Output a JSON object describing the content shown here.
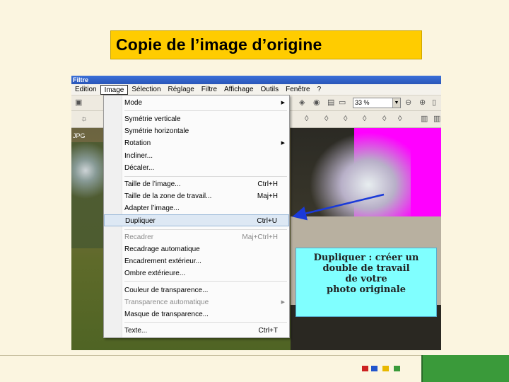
{
  "slide": {
    "title": "Copie de l’image d’origine"
  },
  "window": {
    "title": "Filtre",
    "doc_label": "JPG"
  },
  "menubar": [
    {
      "label": "Edition"
    },
    {
      "label": "Image"
    },
    {
      "label": "Sélection"
    },
    {
      "label": "Réglage"
    },
    {
      "label": "Filtre"
    },
    {
      "label": "Affichage"
    },
    {
      "label": "Outils"
    },
    {
      "label": "Fenêtre"
    },
    {
      "label": "?"
    }
  ],
  "toolbar": {
    "zoom": "33 %",
    "zoom_arrow": "▼"
  },
  "menu": {
    "items": [
      {
        "label": "Mode",
        "shortcut": "",
        "submenu": "▶",
        "disabled": false
      },
      {
        "label": "Symétrie verticale",
        "shortcut": "",
        "submenu": "",
        "disabled": false
      },
      {
        "label": "Symétrie horizontale",
        "shortcut": "",
        "submenu": "",
        "disabled": false
      },
      {
        "label": "Rotation",
        "shortcut": "",
        "submenu": "▶",
        "disabled": false
      },
      {
        "label": "Incliner...",
        "shortcut": "",
        "submenu": "",
        "disabled": false
      },
      {
        "label": "Décaler...",
        "shortcut": "",
        "submenu": "",
        "disabled": false
      },
      {
        "label": "Taille de l’image...",
        "shortcut": "Ctrl+H",
        "submenu": "",
        "disabled": false
      },
      {
        "label": "Taille de la zone de travail...",
        "shortcut": "Maj+H",
        "submenu": "",
        "disabled": false
      },
      {
        "label": "Adapter l’image...",
        "shortcut": "",
        "submenu": "",
        "disabled": false
      },
      {
        "label": "Dupliquer",
        "shortcut": "Ctrl+U",
        "submenu": "",
        "disabled": false
      },
      {
        "label": "Recadrer",
        "shortcut": "Maj+Ctrl+H",
        "submenu": "",
        "disabled": true
      },
      {
        "label": "Recadrage automatique",
        "shortcut": "",
        "submenu": "",
        "disabled": false
      },
      {
        "label": "Encadrement extérieur...",
        "shortcut": "",
        "submenu": "",
        "disabled": false
      },
      {
        "label": "Ombre extérieure...",
        "shortcut": "",
        "submenu": "",
        "disabled": false
      },
      {
        "label": "Couleur de transparence...",
        "shortcut": "",
        "submenu": "",
        "disabled": false
      },
      {
        "label": "Transparence automatique",
        "shortcut": "",
        "submenu": "▶",
        "disabled": true
      },
      {
        "label": "Masque de transparence...",
        "shortcut": "",
        "submenu": "",
        "disabled": false
      },
      {
        "label": "Texte...",
        "shortcut": "Ctrl+T",
        "submenu": "",
        "disabled": false
      }
    ]
  },
  "callout": {
    "line1": "Dupliquer : créer un",
    "line2": "double de travail",
    "line3": "de votre",
    "line4": "photo originale"
  },
  "colors": {
    "title_bg": "#ffcc00",
    "highlight": "#dde8f4",
    "callout_bg": "#80ffff",
    "magenta": "#ff00ff",
    "arrow": "#1a3ad8",
    "footer_red": "#cc2222",
    "footer_blue": "#2255cc",
    "footer_yellow": "#e8b800",
    "footer_green": "#3a9a3a"
  }
}
